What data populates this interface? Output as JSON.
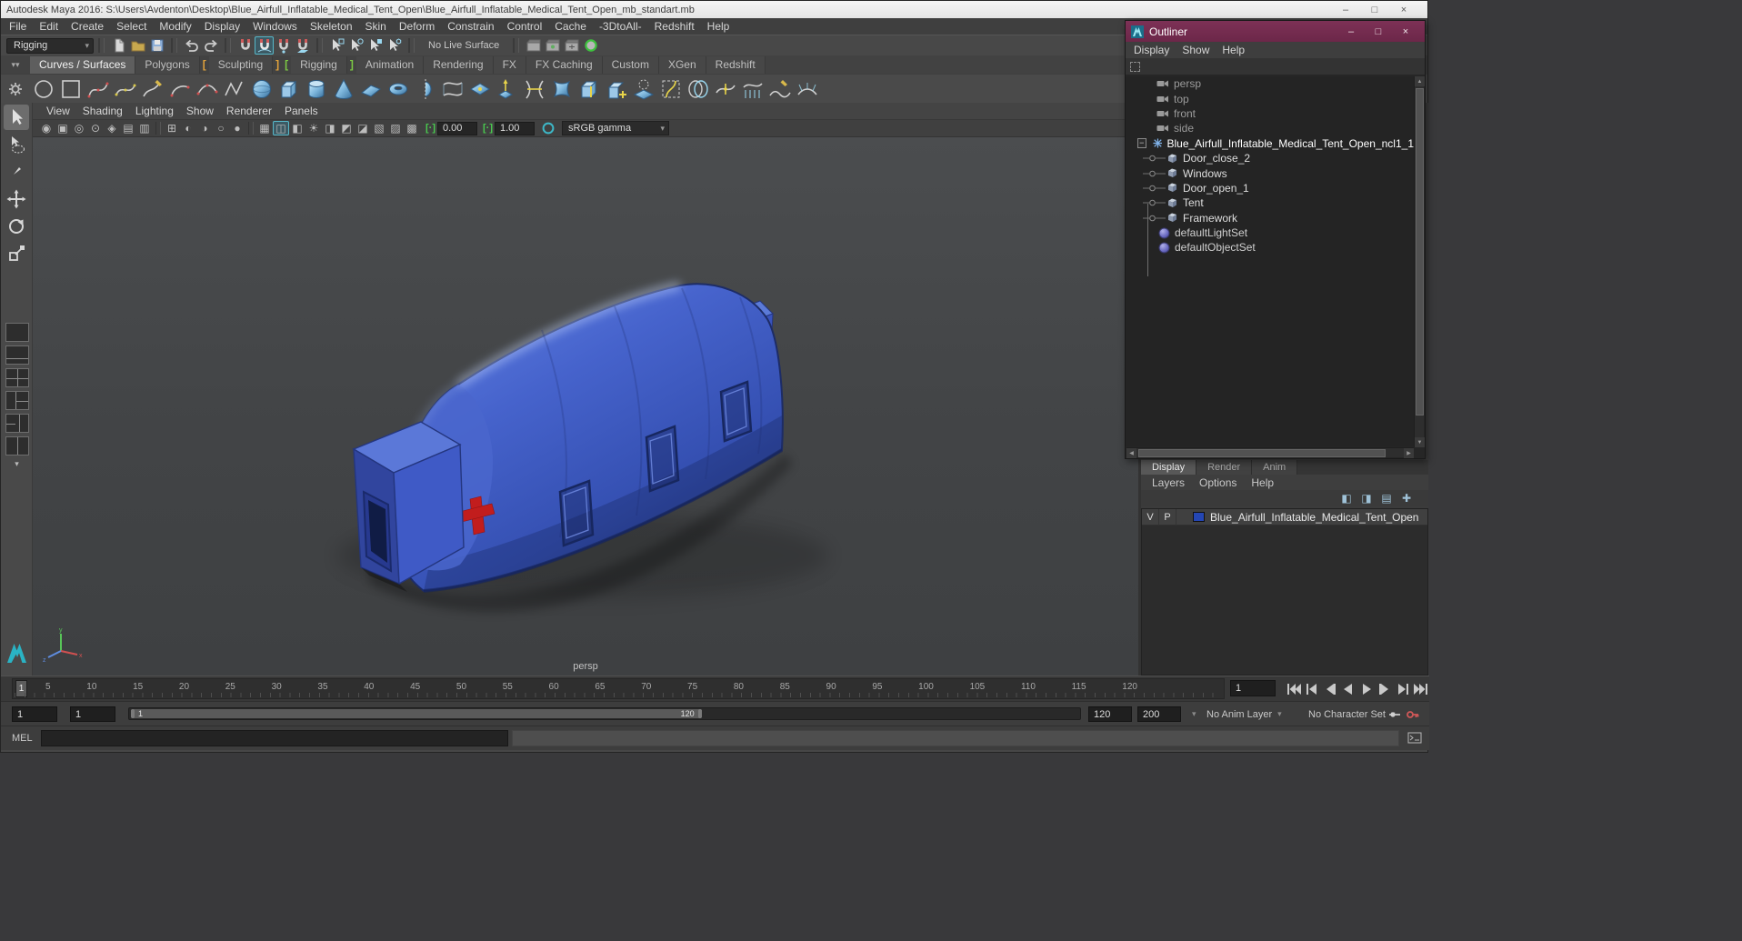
{
  "icons": {
    "minimize": "–",
    "maximize": "□",
    "close": "×",
    "dropdown": "▾",
    "scroll_left": "◀",
    "scroll_right": "▶",
    "scroll_up": "▲",
    "scroll_down": "▼",
    "expand_collapse": "−"
  },
  "colors": {
    "outliner_titlebar": "#6c2749",
    "tent_blue": "#3a57c4",
    "layer_swatch": "#2446b4",
    "gamma_bracket_green": "#49c94f",
    "cross_red": "#c21d1d"
  },
  "window": {
    "title": "Autodesk Maya 2016: S:\\Users\\Avdenton\\Desktop\\Blue_Airfull_Inflatable_Medical_Tent_Open\\Blue_Airfull_Inflatable_Medical_Tent_Open_mb_standart.mb"
  },
  "menu_bar": [
    "File",
    "Edit",
    "Create",
    "Select",
    "Modify",
    "Display",
    "Windows",
    "Skeleton",
    "Skin",
    "Deform",
    "Constrain",
    "Control",
    "Cache",
    "-3DtoAll-",
    "Redshift",
    "Help"
  ],
  "status_line": {
    "menu_set": "Rigging",
    "live_surface": "No Live Surface"
  },
  "shelf": {
    "tabs": [
      "Curves / Surfaces",
      "Polygons",
      "Sculpting",
      "Rigging",
      "Animation",
      "Rendering",
      "FX",
      "FX Caching",
      "Custom",
      "XGen",
      "Redshift"
    ],
    "active_tab": "Curves / Surfaces",
    "marker_open": "[",
    "marker_close": "]"
  },
  "viewport": {
    "menus": [
      "View",
      "Shading",
      "Lighting",
      "Show",
      "Renderer",
      "Panels"
    ],
    "exposure": "0.00",
    "gamma": "1.00",
    "view_transform": "sRGB gamma",
    "camera_label": "persp"
  },
  "outliner": {
    "title": "Outliner",
    "menus": [
      "Display",
      "Show",
      "Help"
    ],
    "items": [
      "persp",
      "top",
      "front",
      "side",
      "Blue_Airfull_Inflatable_Medical_Tent_Open_ncl1_1",
      "Door_close_2",
      "Windows",
      "Door_open_1",
      "Tent",
      "Framework",
      "defaultLightSet",
      "defaultObjectSet"
    ]
  },
  "layer_editor": {
    "tabs": [
      "Display",
      "Render",
      "Anim"
    ],
    "active_tab": "Display",
    "menus": [
      "Layers",
      "Options",
      "Help"
    ],
    "columns": {
      "visibility": "V",
      "playback": "P"
    },
    "layers": [
      {
        "name": "Blue_Airfull_Inflatable_Medical_Tent_Open"
      }
    ]
  },
  "time_slider": {
    "current_frame": "1",
    "ticks": [
      "5",
      "10",
      "15",
      "20",
      "25",
      "30",
      "35",
      "40",
      "45",
      "50",
      "55",
      "60",
      "65",
      "70",
      "75",
      "80",
      "85",
      "90",
      "95",
      "100",
      "105",
      "110",
      "115",
      "120"
    ]
  },
  "range_slider": {
    "playback_start": "1",
    "animation_start": "1",
    "range_bar_start": "1",
    "range_bar_end": "120",
    "playback_end": "120",
    "animation_end": "200",
    "anim_layer": "No Anim Layer",
    "character_set": "No Character Set"
  },
  "command_line": {
    "label": "MEL"
  }
}
